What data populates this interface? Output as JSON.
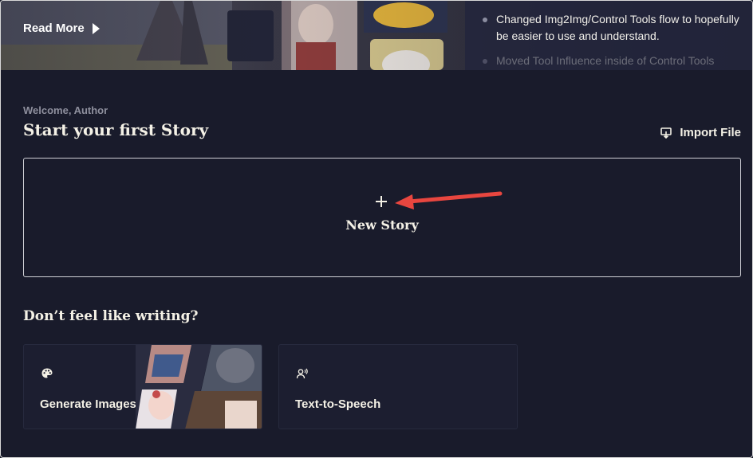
{
  "banner": {
    "read_more": "Read More",
    "changelog": [
      "Changed Img2Img/Control Tools flow to hopefully be easier to use and understand.",
      "Moved Tool Influence inside of Control Tools"
    ]
  },
  "main": {
    "welcome": "Welcome, Author",
    "title": "Start your first Story",
    "import_file": "Import File",
    "new_story": "New Story",
    "new_story_icon": "+"
  },
  "tools": {
    "heading": "Don’t feel like writing?",
    "items": [
      {
        "label": "Generate Images",
        "icon": "palette-icon"
      },
      {
        "label": "Text-to-Speech",
        "icon": "speaking-person-icon"
      }
    ]
  },
  "colors": {
    "background": "#191b2b",
    "text": "#f4f1e6",
    "muted": "#8e8f9d",
    "annotation_arrow": "#e8463f"
  }
}
